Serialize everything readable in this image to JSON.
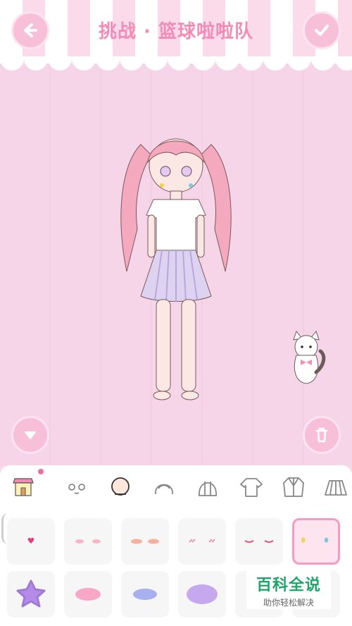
{
  "header": {
    "title": "挑战 · 篮球啦啦队",
    "back_icon": "arrow-left-icon",
    "confirm_icon": "check-icon"
  },
  "stage": {
    "collapse_icon": "triangle-down-icon",
    "trash_icon": "trash-icon"
  },
  "categories": [
    {
      "name": "shop",
      "icon": "shop-icon",
      "notification": true
    },
    {
      "name": "face",
      "icon": "face-icon"
    },
    {
      "name": "head",
      "icon": "head-icon",
      "active": true
    },
    {
      "name": "hair",
      "icon": "hair-icon"
    },
    {
      "name": "hair-back",
      "icon": "hair-back-icon"
    },
    {
      "name": "top",
      "icon": "tshirt-icon"
    },
    {
      "name": "jacket",
      "icon": "jacket-icon"
    },
    {
      "name": "skirt",
      "icon": "skirt-icon"
    }
  ],
  "watermark": {
    "title": "百科全说",
    "subtitle": "助你轻松解决"
  },
  "colors": {
    "accent": "#f08cb5",
    "button": "#f7bfd8",
    "background": "#f6d7ea",
    "selected_border": "#f59bc4"
  }
}
